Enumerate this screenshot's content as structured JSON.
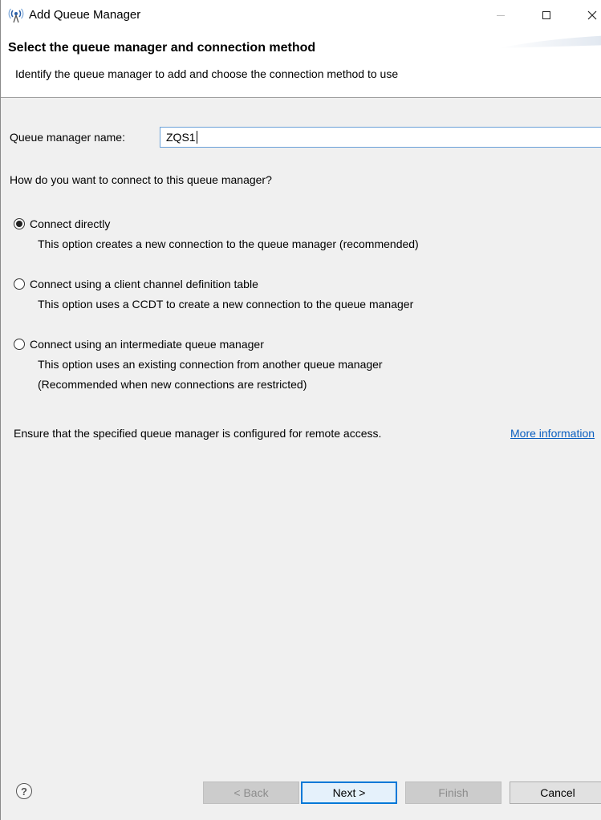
{
  "window": {
    "title": "Add Queue Manager",
    "close_glyph": "✕"
  },
  "banner": {
    "title": "Select the queue manager and connection method",
    "description": "Identify the queue manager to add and choose the connection method to use"
  },
  "form": {
    "qm_name_label": "Queue manager name:",
    "qm_name_value": "ZQS1",
    "question": "How do you want to connect to this queue manager?",
    "options": [
      {
        "label": "Connect directly",
        "desc": "This option creates a new connection to the queue manager (recommended)",
        "selected": true
      },
      {
        "label": "Connect using a client channel definition table",
        "desc": "This option uses a CCDT to create a new connection to the queue manager",
        "selected": false
      },
      {
        "label": "Connect using an intermediate queue manager",
        "desc": "This option uses an existing connection from another queue manager",
        "desc2": "(Recommended when new connections are restricted)",
        "selected": false
      }
    ],
    "remote_note": "Ensure that the specified queue manager is configured for remote access.",
    "more_info": "More information"
  },
  "footer": {
    "help_glyph": "?",
    "back": "< Back",
    "next": "Next >",
    "finish": "Finish",
    "cancel": "Cancel"
  },
  "colors": {
    "link": "#0b5fbf",
    "focus_border": "#0078d7"
  }
}
